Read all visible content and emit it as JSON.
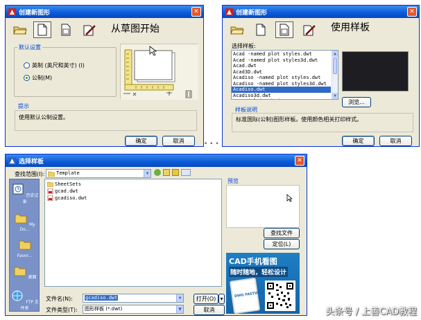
{
  "dialog1": {
    "title": "创建新图形",
    "heading": "从草图开始",
    "group_label": "默认设置",
    "radio_imperial": "英制 (英尺和英寸) (I)",
    "radio_metric": "公制(M)",
    "hint_label": "提示",
    "hint_text": "使用默认公制设置。",
    "ok_label": "确定",
    "cancel_label": "取消"
  },
  "dialog2": {
    "title": "创建新图形",
    "heading": "使用样板",
    "select_label": "选择样板:",
    "templates": [
      "Acad -named plot styles.dwt",
      "Acad -named plot styles3d.dwt",
      "Acad.dwt",
      "Acad3D.dwt",
      "Acadiso -named plot styles.dwt",
      "Acadiso -named plot styles3d.dwt",
      "Acadiso.dwt",
      "Acadiso3d.dwt",
      "Tutorial-iArch.dwt"
    ],
    "selected_index": 6,
    "browse_label": "浏览...",
    "desc_label": "样板说明",
    "desc_text": "标准国际(公制)图形样板。使用颜色相关打印样式。",
    "ok_label": "确定",
    "cancel_label": "取消"
  },
  "dialog3": {
    "title": "选择样板",
    "lookin_label": "查找范围(I):",
    "lookin_value": "Template",
    "preview_label": "预览",
    "files": [
      {
        "name": "SheetSets",
        "type": "folder"
      },
      {
        "name": "gcad.dwt",
        "type": "file"
      },
      {
        "name": "gcadiso.dwt",
        "type": "file"
      }
    ],
    "places": [
      "历史记录",
      "My Do...",
      "Favor...",
      "桌面",
      "FTP 文件夹"
    ],
    "find_file_label": "查找文件(F)...",
    "locate_label": "定位(L)",
    "filename_label": "文件名(N):",
    "filename_value": "gcadiso.dwt",
    "filetype_label": "文件类型(T):",
    "filetype_value": "图形样板 (*.dwt)",
    "open_label": "打开(O)",
    "cancel_label": "取消"
  },
  "ad": {
    "line1": "CAD手机看图",
    "line2": "随时随地，轻松设计",
    "logo": "DWG FASTVIEW"
  },
  "watermark": "头条号 / 上善CAD教程"
}
